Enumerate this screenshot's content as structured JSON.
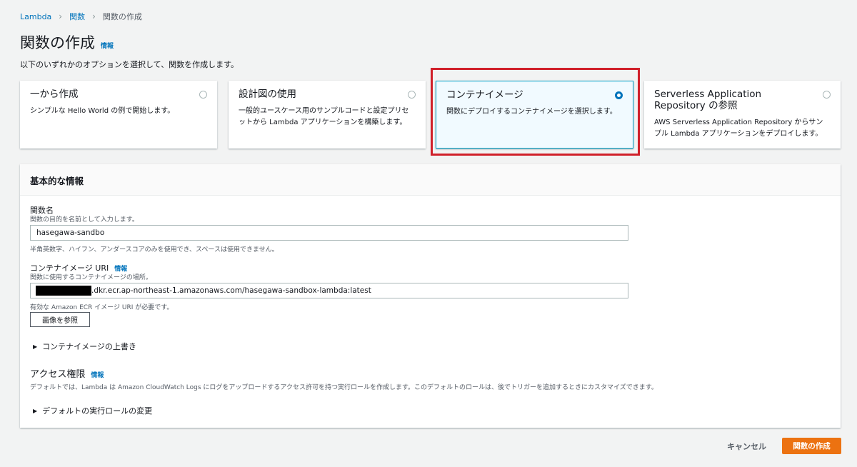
{
  "breadcrumb": {
    "items": [
      "Lambda",
      "関数",
      "関数の作成"
    ]
  },
  "page": {
    "title": "関数の作成",
    "info": "情報",
    "subtitle": "以下のいずれかのオプションを選択して、関数を作成します。"
  },
  "options": [
    {
      "title": "一から作成",
      "description": "シンプルな Hello World の例で開始します。",
      "selected": false
    },
    {
      "title": "設計図の使用",
      "description": "一般的ユースケース用のサンプルコードと設定プリセットから Lambda アプリケーションを構築します。",
      "selected": false
    },
    {
      "title": "コンテナイメージ",
      "description": "関数にデプロイするコンテナイメージを選択します。",
      "selected": true
    },
    {
      "title": "Serverless Application Repository の参照",
      "description": "AWS Serverless Application Repository からサンプル Lambda アプリケーションをデプロイします。",
      "selected": false
    }
  ],
  "basic_info": {
    "header": "基本的な情報",
    "function_name": {
      "label": "関数名",
      "description": "関数の目的を名前として入力します。",
      "value": "hasegawa-sandbo",
      "hint": "半角英数字、ハイフン、アンダースコアのみを使用でき、スペースは使用できません。"
    },
    "image_uri": {
      "label": "コンテナイメージ URI",
      "info": "情報",
      "description": "関数に使用するコンテナイメージの場所。",
      "value": ".dkr.ecr.ap-northeast-1.amazonaws.com/hasegawa-sandbox-lambda:latest",
      "hint": "有効な Amazon ECR イメージ URI が必要です。",
      "browse_label": "画像を参照"
    },
    "override_label": "コンテナイメージの上書き",
    "permissions": {
      "title": "アクセス権限",
      "info": "情報",
      "description": "デフォルトでは、Lambda は Amazon CloudWatch Logs にログをアップロードするアクセス許可を持つ実行ロールを作成します。このデフォルトのロールは、後でトリガーを追加するときにカスタマイズできます。",
      "role_label": "デフォルトの実行ロールの変更"
    }
  },
  "footer": {
    "cancel": "キャンセル",
    "create": "関数の作成"
  },
  "colors": {
    "accent": "#0073bb",
    "primary_button": "#ec7211",
    "highlight": "#d0202a",
    "selected_bg": "#f1faff"
  },
  "icons": {
    "breadcrumb_separator": "chevron-right-icon",
    "expander": "caret-right-icon"
  }
}
